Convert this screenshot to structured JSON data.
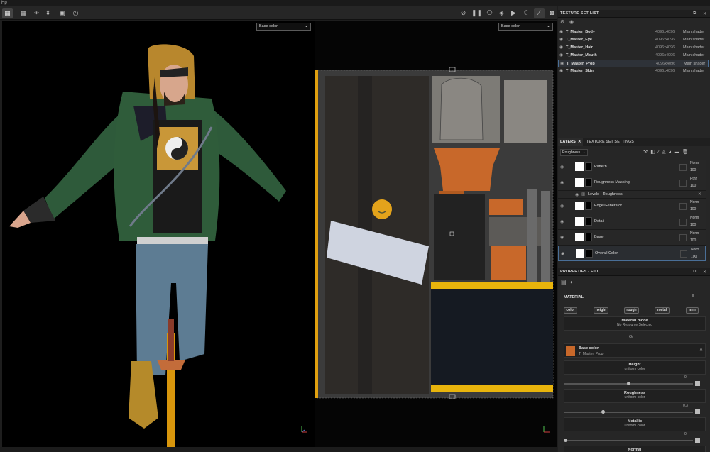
{
  "menubar": {
    "label": "Hp"
  },
  "viewport3d": {
    "channel": "Base color"
  },
  "viewport2d": {
    "channel": "Base color"
  },
  "texture_set_list": {
    "title": "TEXTURE SET LIST",
    "rows": [
      {
        "name": "T_Master_Body",
        "res": "4096x4096",
        "shader": "Main shader"
      },
      {
        "name": "T_Master_Eye",
        "res": "4096x4096",
        "shader": "Main shader"
      },
      {
        "name": "T_Master_Hair",
        "res": "4096x4096",
        "shader": "Main shader"
      },
      {
        "name": "T_Master_Mouth",
        "res": "4096x4096",
        "shader": "Main shader"
      },
      {
        "name": "T_Master_Prop",
        "res": "4096x4096",
        "shader": "Main shader"
      },
      {
        "name": "T_Master_Skin",
        "res": "4096x4096",
        "shader": "Main shader"
      }
    ],
    "selected_index": 4
  },
  "layers": {
    "tab_layers": "LAYERS",
    "tab_settings": "TEXTURE SET SETTINGS",
    "channel_dropdown": "Roughness",
    "items": [
      {
        "name": "Pattern",
        "blend": "Norm",
        "opacity": "100"
      },
      {
        "name": "Roughness Masking",
        "blend": "Pthr",
        "opacity": "100"
      },
      {
        "name": "Levels - Roughness",
        "sub": true
      },
      {
        "name": "Edge Generator",
        "blend": "Norm",
        "opacity": "100"
      },
      {
        "name": "Detail",
        "blend": "Norm",
        "opacity": "100"
      },
      {
        "name": "Base",
        "blend": "Norm",
        "opacity": "100"
      },
      {
        "name": "Overall Color",
        "blend": "Norm",
        "opacity": "100"
      }
    ]
  },
  "properties": {
    "title": "PROPERTIES - FILL",
    "material_label": "MATERIAL",
    "buttons": [
      "color",
      "height",
      "rough",
      "metal",
      "nrm"
    ],
    "material_mode": {
      "title": "Material mode",
      "value": "No Resource Selected"
    },
    "or_label": "Or",
    "base_color": {
      "title": "Base color",
      "value": "T_Master_Prop"
    },
    "height": {
      "title": "Height",
      "value": "uniform color",
      "slider_value": "0",
      "fraction": 0.5
    },
    "roughness": {
      "title": "Roughness",
      "value": "uniform color",
      "slider_value": "0.3",
      "fraction": 0.3
    },
    "metallic": {
      "title": "Metallic",
      "value": "uniform color",
      "slider_value": "0",
      "fraction": 0.0
    },
    "normal": {
      "title": "Normal"
    }
  },
  "colors": {
    "accent": "#4a6f97",
    "uv_yellow": "#e6a400",
    "uv_orange": "#c8682a"
  }
}
